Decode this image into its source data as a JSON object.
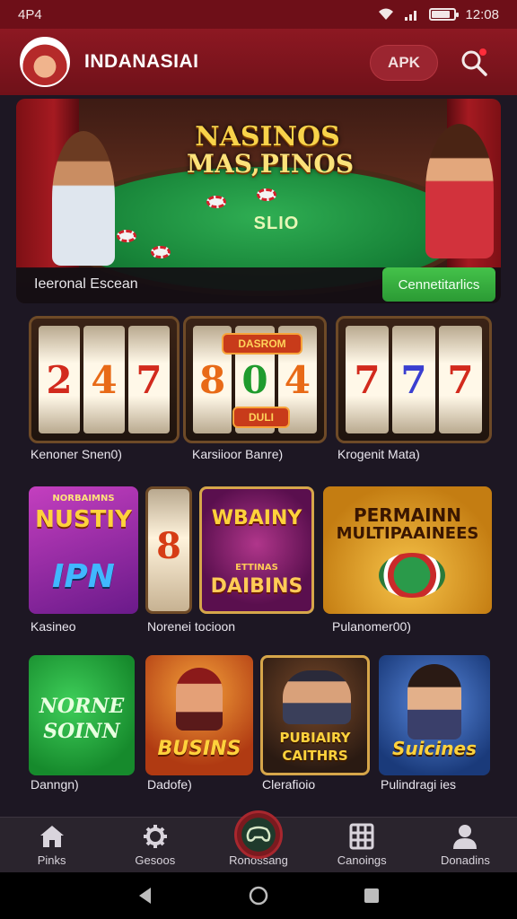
{
  "status_bar": {
    "left": "4P4",
    "time": "12:08"
  },
  "header": {
    "title": "INDANASIAI",
    "apk_label": "APK"
  },
  "banner": {
    "title_line1": "NASINOS",
    "title_line2": "MAS,PINOS",
    "sub": "SLIO",
    "caption": "Ieeronal Escean",
    "cta": "Cennetitarlics"
  },
  "slots": [
    {
      "label": "Kenoner Snen0)",
      "reels": [
        "2",
        "4",
        "7"
      ],
      "colors": [
        "red",
        "orange",
        "red"
      ]
    },
    {
      "label": "Karsiioor Banre)",
      "reels": [
        "8",
        "0",
        "4"
      ],
      "colors": [
        "orange",
        "green",
        "orange"
      ],
      "marquee_top": "DASROM",
      "marquee_bottom": "DULI"
    },
    {
      "label": "Krogenit Mata)",
      "reels": [
        "7",
        "7",
        "7"
      ],
      "colors": [
        "red",
        "blue",
        "red"
      ]
    }
  ],
  "games_row2": [
    {
      "label": "Kasineo",
      "text1": "NUSTIY",
      "text2": "IPN",
      "tag": "NORBAIMNS"
    },
    {
      "label": "Norenei tocioon",
      "text1": "8",
      "text2": "WBAINY",
      "text3": "DAIBINS",
      "tag": "ETTINAS"
    },
    {
      "label": "Pulanomer00)",
      "text1": "PERMAINN",
      "text2": "MULTIPAAINEES"
    }
  ],
  "games_row3": [
    {
      "label": "Danngn)",
      "text1": "NORNE",
      "text2": "SOINN"
    },
    {
      "label": "Dadofe)",
      "text1": "BUSINS"
    },
    {
      "label": "Clerafioio",
      "text1": "PUBIAIRY",
      "text2": "CAITHRS"
    },
    {
      "label": "Pulindragi ies",
      "text1": "Suicines"
    }
  ],
  "bottom_nav": [
    {
      "label": "Pinks",
      "icon": "home-icon"
    },
    {
      "label": "Gesoos",
      "icon": "gear-icon"
    },
    {
      "label": "Ronossang",
      "icon": "gamepad-icon"
    },
    {
      "label": "Canoings",
      "icon": "grid-icon"
    },
    {
      "label": "Donadins",
      "icon": "user-icon"
    }
  ]
}
